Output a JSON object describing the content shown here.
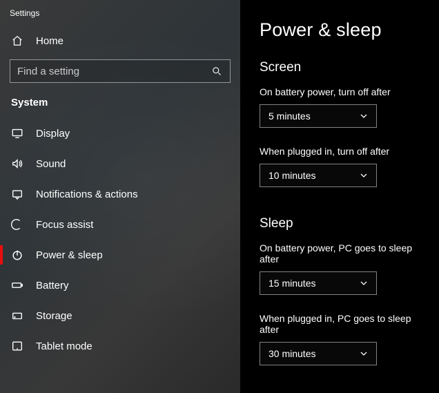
{
  "app_title": "Settings",
  "home_label": "Home",
  "search": {
    "placeholder": "Find a setting"
  },
  "category": "System",
  "nav": [
    {
      "label": "Display",
      "icon": "display-icon"
    },
    {
      "label": "Sound",
      "icon": "sound-icon"
    },
    {
      "label": "Notifications & actions",
      "icon": "notifications-icon"
    },
    {
      "label": "Focus assist",
      "icon": "focus-assist-icon"
    },
    {
      "label": "Power & sleep",
      "icon": "power-icon",
      "active": true
    },
    {
      "label": "Battery",
      "icon": "battery-icon"
    },
    {
      "label": "Storage",
      "icon": "storage-icon"
    },
    {
      "label": "Tablet mode",
      "icon": "tablet-icon"
    }
  ],
  "page": {
    "title": "Power & sleep",
    "sections": [
      {
        "title": "Screen",
        "fields": [
          {
            "label": "On battery power, turn off after",
            "value": "5 minutes"
          },
          {
            "label": "When plugged in, turn off after",
            "value": "10 minutes"
          }
        ]
      },
      {
        "title": "Sleep",
        "fields": [
          {
            "label": "On battery power, PC goes to sleep after",
            "value": "15 minutes"
          },
          {
            "label": "When plugged in, PC goes to sleep after",
            "value": "30 minutes"
          }
        ]
      }
    ]
  }
}
